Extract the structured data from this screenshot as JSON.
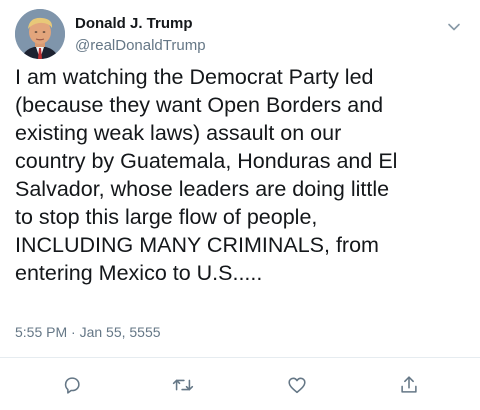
{
  "tweet": {
    "author": {
      "name": "Donald J. Trump",
      "handle": "@realDonaldTrump"
    },
    "text_lines": [
      "I am watching the Democrat Party led",
      "(because they want Open Borders and",
      "existing weak laws) assault on our",
      "country by Guatemala, Honduras and El",
      "Salvador, whose leaders are doing little",
      "to stop this large flow of people,",
      "INCLUDING MANY CRIMINALS, from",
      "entering Mexico to U.S....."
    ],
    "timestamp": "5:55 PM · Jan 55, 5555"
  },
  "icons": {
    "menu": "chevron-down-icon",
    "reply": "reply-icon",
    "retweet": "retweet-icon",
    "like": "heart-icon",
    "share": "share-icon"
  },
  "colors": {
    "text": "#14171a",
    "secondary": "#657786",
    "icon": "#657786",
    "divider": "#e6ecf0"
  }
}
